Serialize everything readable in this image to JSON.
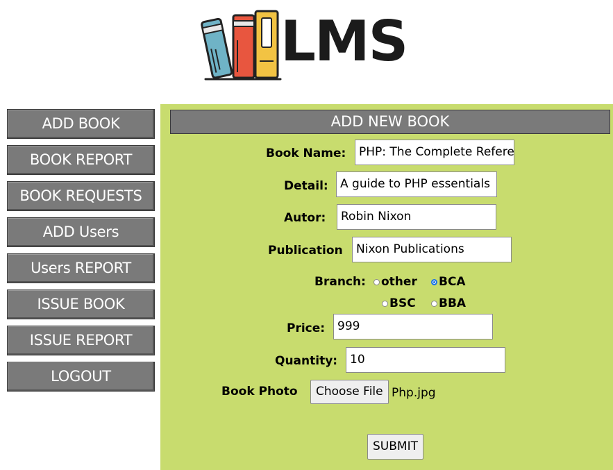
{
  "logo": {
    "text": "LMS"
  },
  "sidebar": {
    "items": [
      {
        "label": "ADD BOOK"
      },
      {
        "label": "BOOK REPORT"
      },
      {
        "label": "BOOK REQUESTS"
      },
      {
        "label": "ADD Users"
      },
      {
        "label": "Users REPORT"
      },
      {
        "label": "ISSUE BOOK"
      },
      {
        "label": "ISSUE REPORT"
      },
      {
        "label": "LOGOUT"
      }
    ]
  },
  "form": {
    "title": "ADD NEW BOOK",
    "book_name": {
      "label": "Book Name:",
      "value": "PHP: The Complete Refere"
    },
    "detail": {
      "label": "Detail:",
      "value": "A guide to PHP essentials"
    },
    "author": {
      "label": "Autor:",
      "value": "Robin Nixon"
    },
    "publication": {
      "label": "Publication",
      "value": "Nixon Publications"
    },
    "branch": {
      "label": "Branch:",
      "options": [
        {
          "label": "other",
          "checked": false
        },
        {
          "label": "BCA",
          "checked": true
        },
        {
          "label": "BSC",
          "checked": false
        },
        {
          "label": "BBA",
          "checked": false
        }
      ]
    },
    "price": {
      "label": "Price:",
      "value": "999"
    },
    "quantity": {
      "label": "Quantity:",
      "value": "10"
    },
    "photo": {
      "label": "Book Photo",
      "button": "Choose File",
      "file": "Php.jpg"
    },
    "submit": "SUBMIT"
  },
  "colors": {
    "panel_bg": "#c8dc6e",
    "button_bg": "#7a7a7a",
    "radio_checked": "#1a73e8"
  }
}
